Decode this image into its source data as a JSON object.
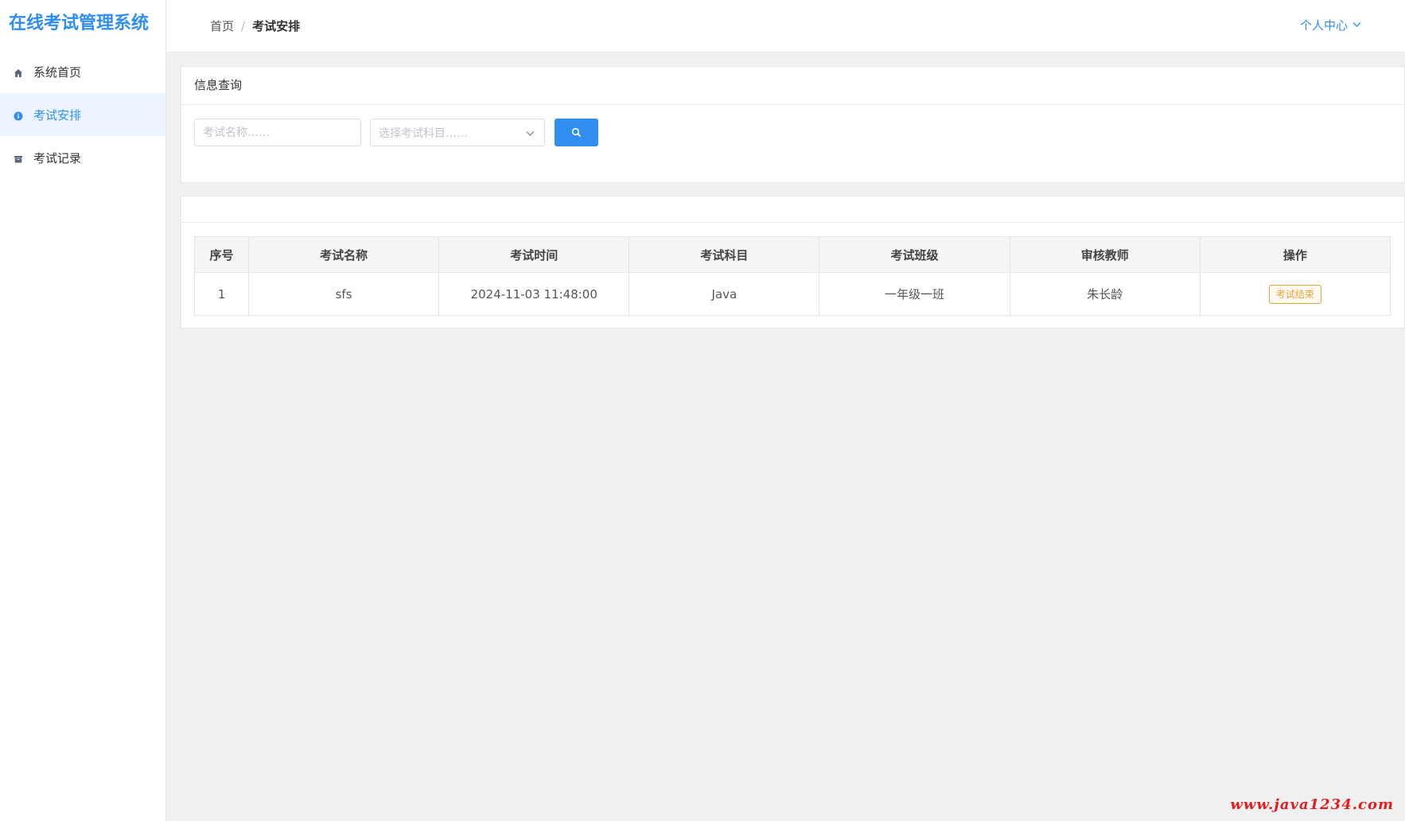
{
  "app": {
    "title": "在线考试管理系统"
  },
  "sidebar": {
    "items": [
      {
        "label": "系统首页",
        "icon": "home-icon",
        "active": false
      },
      {
        "label": "考试安排",
        "icon": "info-circle-icon",
        "active": true
      },
      {
        "label": "考试记录",
        "icon": "archive-box-icon",
        "active": false
      }
    ]
  },
  "header": {
    "breadcrumb": {
      "home": "首页",
      "separator": "/",
      "current": "考试安排"
    },
    "user_menu": "个人中心"
  },
  "search": {
    "card_title": "信息查询",
    "name_placeholder": "考试名称……",
    "subject_placeholder": "选择考试科目……"
  },
  "table": {
    "columns": [
      "序号",
      "考试名称",
      "考试时间",
      "考试科目",
      "考试班级",
      "审核教师",
      "操作"
    ],
    "rows": [
      {
        "index": "1",
        "name": "sfs",
        "time": "2024-11-03 11:48:00",
        "subject": "Java",
        "class": "一年级一班",
        "teacher": "朱长龄",
        "action": "考试结束"
      }
    ]
  },
  "watermark": "www.java1234.com",
  "colors": {
    "accent": "#2f8ef0",
    "active_bg": "#ecf5ff",
    "warning": "#e6a23c",
    "watermark": "#e02020"
  }
}
